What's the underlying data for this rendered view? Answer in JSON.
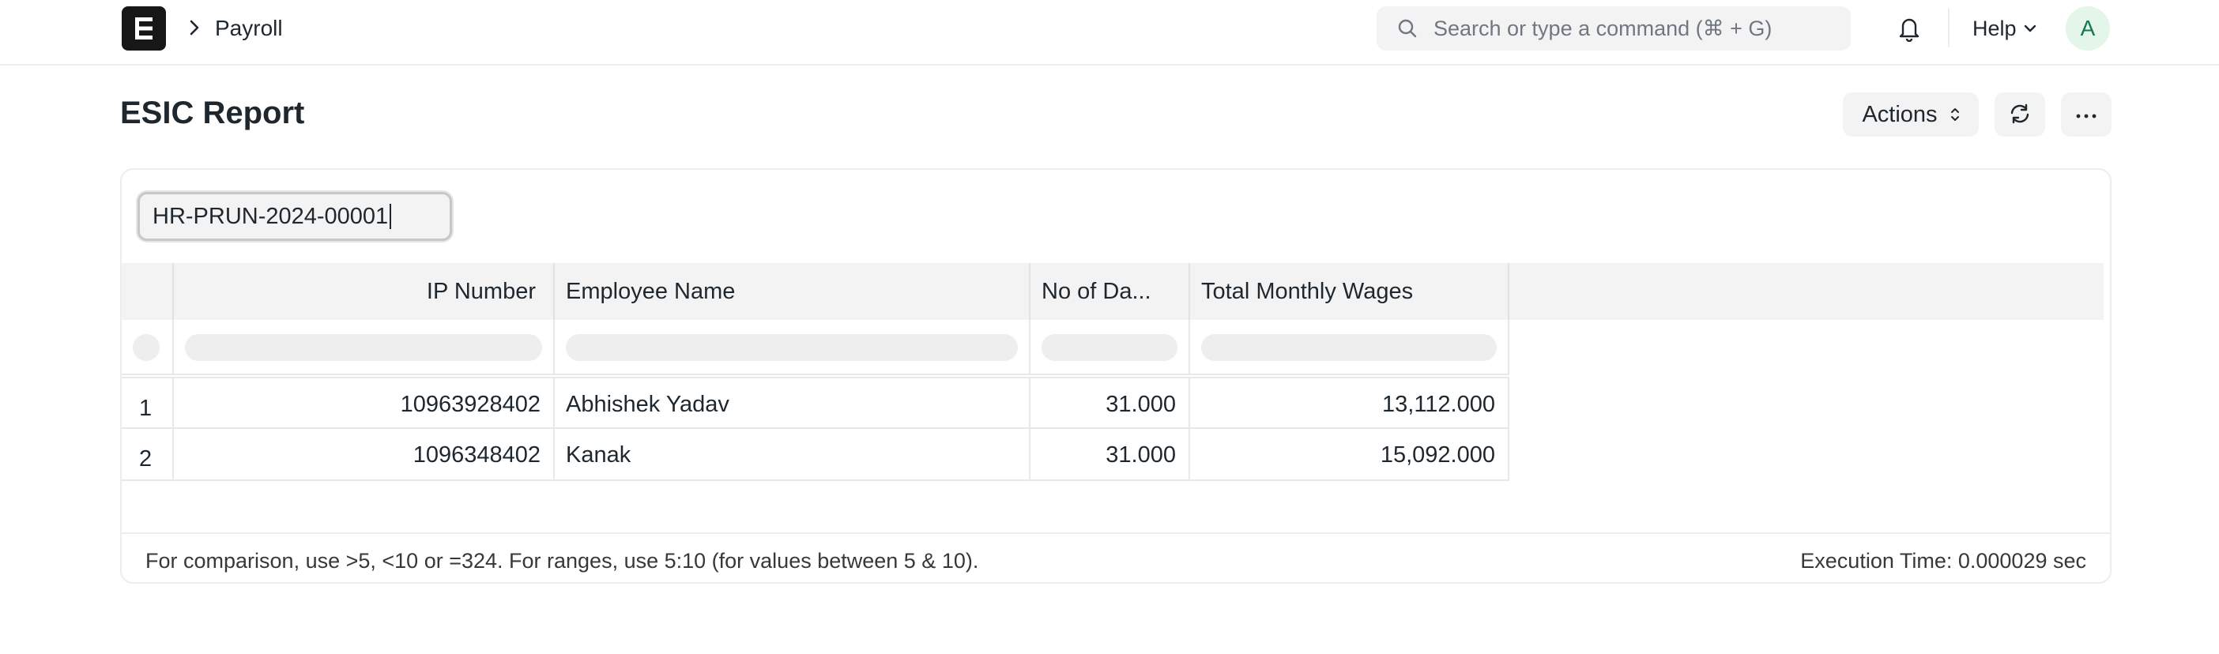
{
  "navbar": {
    "logo_letter": "E",
    "breadcrumb": "Payroll",
    "search_placeholder": "Search or type a command (⌘ + G)",
    "help_label": "Help",
    "avatar_initial": "A"
  },
  "page": {
    "title": "ESIC Report",
    "actions_label": "Actions"
  },
  "filter": {
    "value": "HR-PRUN-2024-00001"
  },
  "table": {
    "columns": [
      "IP Number",
      "Employee Name",
      "No of Da...",
      "Total Monthly Wages"
    ],
    "rows": [
      {
        "index": "1",
        "ip_number": "10963928402",
        "employee_name": "Abhishek Yadav",
        "days": "31.000",
        "wages": "13,112.000"
      },
      {
        "index": "2",
        "ip_number": "1096348402",
        "employee_name": "Kanak",
        "days": "31.000",
        "wages": "15,092.000"
      }
    ]
  },
  "footer": {
    "hint": "For comparison, use >5, <10 or =324. For ranges, use 5:10 (for values between 5 & 10).",
    "execution_time": "Execution Time: 0.000029 sec"
  },
  "colors": {
    "avatar_bg": "#e4f5e9",
    "avatar_text": "#16794c",
    "logo_bg": "#171717"
  }
}
